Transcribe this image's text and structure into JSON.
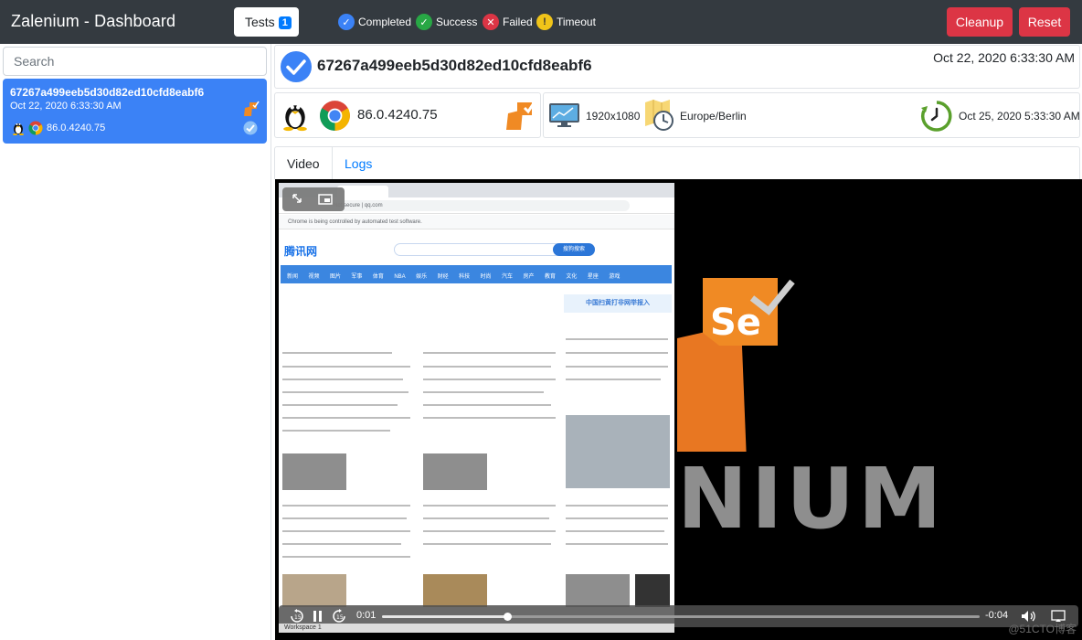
{
  "navbar": {
    "brand": "Zalenium - Dashboard",
    "tests_label": "Tests",
    "tests_count": "1",
    "legend": [
      {
        "label": "Completed",
        "color": "#3b82f6",
        "icon": "check-icon"
      },
      {
        "label": "Success",
        "color": "#28a745",
        "icon": "check-icon"
      },
      {
        "label": "Failed",
        "color": "#dc3545",
        "icon": "x-icon"
      },
      {
        "label": "Timeout",
        "color": "#f0c419",
        "icon": "exclamation-icon"
      }
    ],
    "cleanup_label": "Cleanup",
    "reset_label": "Reset"
  },
  "sidebar": {
    "search_placeholder": "Search",
    "tests": [
      {
        "id": "67267a499eeb5d30d82ed10cfd8eabf6",
        "date": "Oct 22, 2020 6:33:30 AM",
        "browser_version": "86.0.4240.75",
        "os_icon": "linux-icon",
        "browser_icon": "chrome-icon",
        "status_icon": "check-circle-icon"
      }
    ]
  },
  "test": {
    "id": "67267a499eeb5d30d82ed10cfd8eabf6",
    "date": "Oct 22, 2020 6:33:30 AM",
    "browser_version": "86.0.4240.75",
    "resolution": "1920x1080",
    "timezone": "Europe/Berlin",
    "retention_date": "Oct 25, 2020 5:33:30 AM"
  },
  "tabs": [
    {
      "label": "Video",
      "active": true
    },
    {
      "label": "Logs",
      "active": false
    }
  ],
  "player": {
    "elapsed": "0:01",
    "remaining": "-0:04",
    "progress_fraction": 0.21
  },
  "recording": {
    "url": "Not secure | qq.com",
    "infobar": "Chrome is being controlled by automated test software.",
    "site_logo": "腾讯网",
    "search_button": "搜狗搜索",
    "nav_items": [
      "新闻",
      "视频",
      "图片",
      "军事",
      "体育",
      "NBA",
      "娱乐",
      "财经",
      "科技",
      "时尚",
      "汽车",
      "房产",
      "教育",
      "文化",
      "星座",
      "游戏"
    ],
    "banner": "中国扫黄打非网举报入",
    "brand_text": "NIUM",
    "taskbar": "Workspace 1",
    "watermark": "@51CTO博客"
  }
}
